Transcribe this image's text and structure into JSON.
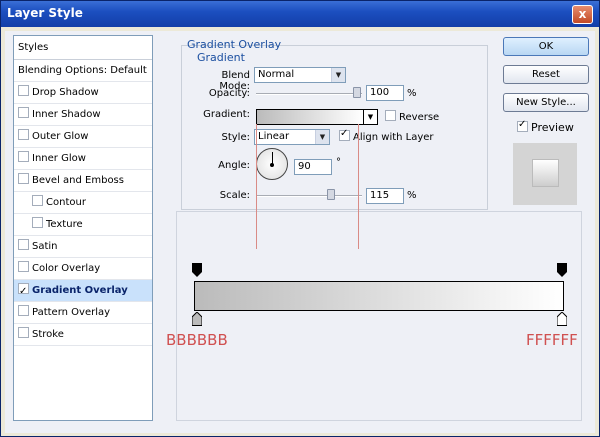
{
  "window": {
    "title": "Layer Style",
    "close_label": "x"
  },
  "styles_list": {
    "header": "Styles",
    "blending": "Blending Options: Default",
    "items": [
      {
        "label": "Drop Shadow",
        "checked": false,
        "indent": false
      },
      {
        "label": "Inner Shadow",
        "checked": false,
        "indent": false
      },
      {
        "label": "Outer Glow",
        "checked": false,
        "indent": false
      },
      {
        "label": "Inner Glow",
        "checked": false,
        "indent": false
      },
      {
        "label": "Bevel and Emboss",
        "checked": false,
        "indent": false
      },
      {
        "label": "Contour",
        "checked": false,
        "indent": true
      },
      {
        "label": "Texture",
        "checked": false,
        "indent": true
      },
      {
        "label": "Satin",
        "checked": false,
        "indent": false
      },
      {
        "label": "Color Overlay",
        "checked": false,
        "indent": false
      },
      {
        "label": "Gradient Overlay",
        "checked": true,
        "indent": false,
        "selected": true
      },
      {
        "label": "Pattern Overlay",
        "checked": false,
        "indent": false
      },
      {
        "label": "Stroke",
        "checked": false,
        "indent": false
      }
    ]
  },
  "gradient_overlay": {
    "title": "Gradient Overlay",
    "subtitle": "Gradient",
    "blend_mode_label": "Blend Mode:",
    "blend_mode_value": "Normal",
    "opacity_label": "Opacity:",
    "opacity_value": "100",
    "opacity_unit": "%",
    "gradient_label": "Gradient:",
    "reverse_label": "Reverse",
    "style_label": "Style:",
    "style_value": "Linear",
    "align_label": "Align with Layer",
    "align_checked": true,
    "angle_label": "Angle:",
    "angle_value": "90",
    "angle_unit": "°",
    "scale_label": "Scale:",
    "scale_value": "115",
    "scale_unit": "%"
  },
  "buttons": {
    "ok": "OK",
    "reset": "Reset",
    "new_style": "New Style..."
  },
  "preview": {
    "label": "Preview",
    "checked": true
  },
  "gradient_editor": {
    "start_color": "BBBBBB",
    "end_color": "FFFFFF",
    "start_hex": "#bbbbbb",
    "end_hex": "#ffffff",
    "label_color": "#d05050"
  }
}
